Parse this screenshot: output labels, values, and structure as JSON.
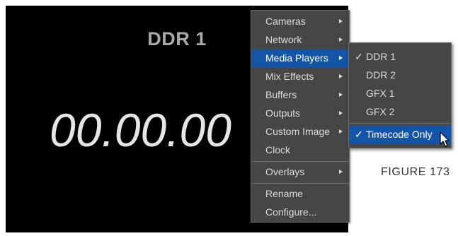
{
  "monitor": {
    "title": "DDR 1",
    "timecode": "00.00.00"
  },
  "menu": {
    "items": [
      {
        "label": "Cameras",
        "submenu": true,
        "selected": false
      },
      {
        "label": "Network",
        "submenu": true,
        "selected": false
      },
      {
        "label": "Media Players",
        "submenu": true,
        "selected": true
      },
      {
        "label": "Mix Effects",
        "submenu": true,
        "selected": false
      },
      {
        "label": "Buffers",
        "submenu": true,
        "selected": false
      },
      {
        "label": "Outputs",
        "submenu": true,
        "selected": false
      },
      {
        "label": "Custom Image",
        "submenu": true,
        "selected": false
      },
      {
        "label": "Clock",
        "submenu": false,
        "selected": false
      },
      {
        "label": "Overlays",
        "submenu": true,
        "selected": false
      },
      {
        "label": "Rename",
        "submenu": false,
        "selected": false
      },
      {
        "label": "Configure...",
        "submenu": false,
        "selected": false
      }
    ]
  },
  "submenu": {
    "items": [
      {
        "label": "DDR 1",
        "checked": true,
        "selected": false
      },
      {
        "label": "DDR 2",
        "checked": false,
        "selected": false
      },
      {
        "label": "GFX 1",
        "checked": false,
        "selected": false
      },
      {
        "label": "GFX 2",
        "checked": false,
        "selected": false
      },
      {
        "label": "Timecode Only",
        "checked": true,
        "selected": true
      }
    ],
    "check_glyph": "✓"
  },
  "figure": {
    "label": "FIGURE 173"
  },
  "colors": {
    "highlight": "#1356a8",
    "menu_bg": "#464646",
    "monitor_bg": "#000000"
  }
}
